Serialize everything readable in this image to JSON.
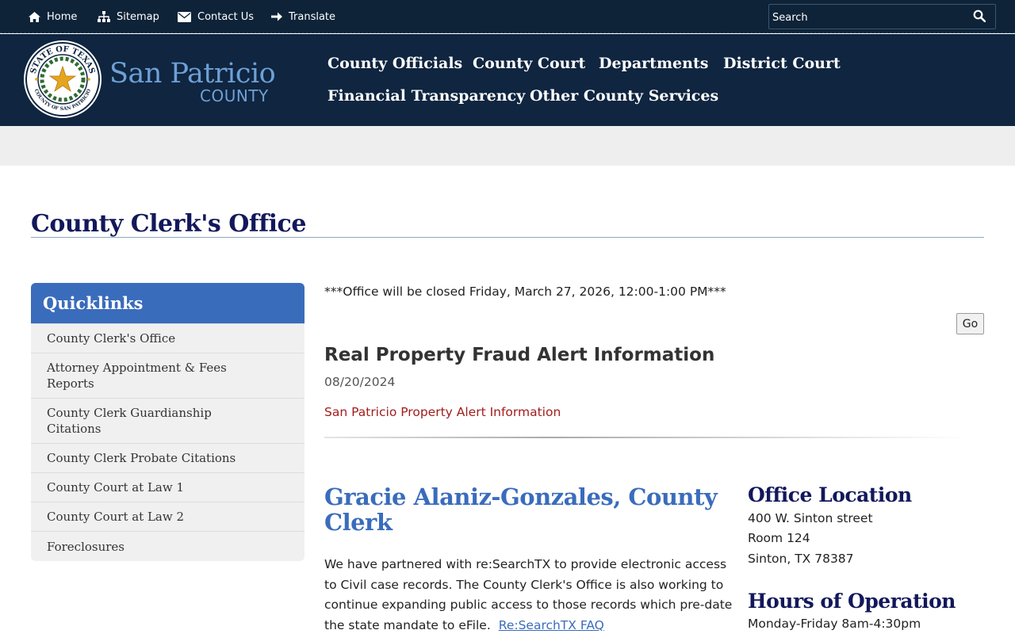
{
  "utility_nav": {
    "home": "Home",
    "sitemap": "Sitemap",
    "contact": "Contact Us",
    "translate": "Translate",
    "search_placeholder": "Search"
  },
  "brand": {
    "name": "San Patricio",
    "sub": "COUNTY",
    "seal_text_top": "STATE OF TEXAS",
    "seal_text_bottom": "COUNTY OF SAN PATRICIO"
  },
  "main_nav": [
    {
      "label": "County Officials"
    },
    {
      "label": "County Court"
    },
    {
      "label": "Departments"
    },
    {
      "label": "District Court"
    },
    {
      "label": "Financial Transparency"
    },
    {
      "label": "Other County Services"
    }
  ],
  "page_title": "County Clerk's Office",
  "quicklinks": {
    "heading": "Quicklinks",
    "items": [
      {
        "label": "County Clerk's Office"
      },
      {
        "label": "Attorney Appointment & Fees Reports"
      },
      {
        "label": "County Clerk Guardianship Citations"
      },
      {
        "label": "County Clerk Probate Citations"
      },
      {
        "label": "County Court at Law 1"
      },
      {
        "label": "County Court at Law 2"
      },
      {
        "label": "Foreclosures"
      }
    ]
  },
  "notice": "***Office will be closed Friday, March 27, 2026, 12:00-1:00 PM***",
  "go_button": "Go",
  "news": {
    "title": "Real Property Fraud Alert Information",
    "date": "08/20/2024",
    "link": "San Patricio Property Alert Information"
  },
  "clerk": {
    "name": "Gracie Alaniz-Gonzales, County Clerk",
    "body": "We have partnered with re:SearchTX to provide electronic access to Civil case records.  The County Clerk's Office is also working to continue expanding public access to those records which pre-date the state mandate to eFile.",
    "faq_link": "Re:SearchTX FAQ"
  },
  "office_location": {
    "heading": "Office Location",
    "line1": "400 W. Sinton street",
    "line2": "Room 124",
    "line3": "Sinton, TX 78387"
  },
  "hours": {
    "heading": "Hours of Operation",
    "line1": "Monday-Friday 8am-4:30pm"
  },
  "colors": {
    "topbar": "#0e2338",
    "header": "#0f2540",
    "accent_blue": "#3a6cbc",
    "title_navy": "#12185a",
    "link_red": "#a31c1c"
  }
}
